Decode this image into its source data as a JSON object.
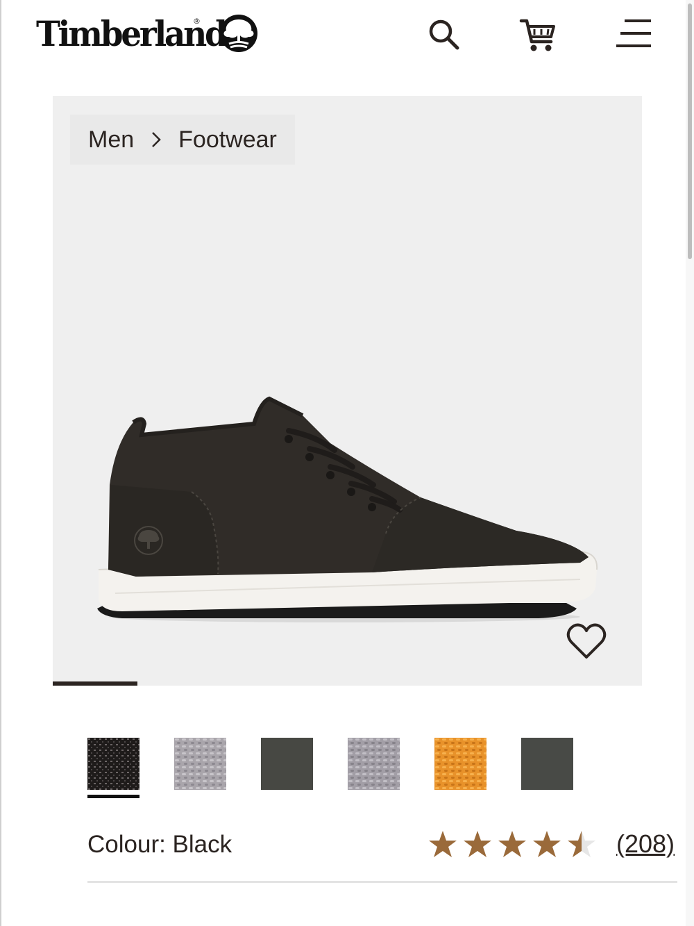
{
  "header": {
    "brand": "Timberland",
    "registered_mark": "®",
    "icons": [
      "search-icon",
      "cart-icon",
      "menu-icon"
    ]
  },
  "breadcrumb": {
    "items": [
      {
        "label": "Men"
      },
      {
        "label": "Footwear"
      }
    ]
  },
  "gallery": {
    "product_image": "black-chukka-sneaker",
    "wishlist_icon": "heart-icon",
    "active_slide": 1
  },
  "swatches": {
    "items": [
      {
        "name": "black-textile",
        "color": "#1e1b1a",
        "selected": true
      },
      {
        "name": "grey-textile",
        "color": "#a9a5ab",
        "selected": false
      },
      {
        "name": "dark-olive-nubuck",
        "color": "#474843",
        "selected": false
      },
      {
        "name": "light-grey-textile",
        "color": "#a29ea6",
        "selected": false
      },
      {
        "name": "wheat-textile",
        "color": "#e8922a",
        "selected": false
      },
      {
        "name": "dark-grey-nubuck",
        "color": "#484a46",
        "selected": false
      }
    ]
  },
  "product": {
    "colour_label": "Colour: Black",
    "rating": 4.5,
    "rating_max": 5,
    "review_count": "(208)"
  },
  "colors": {
    "brand_dark": "#2b2421",
    "star": "#9a6a3a",
    "gallery_bg": "#efefef"
  }
}
